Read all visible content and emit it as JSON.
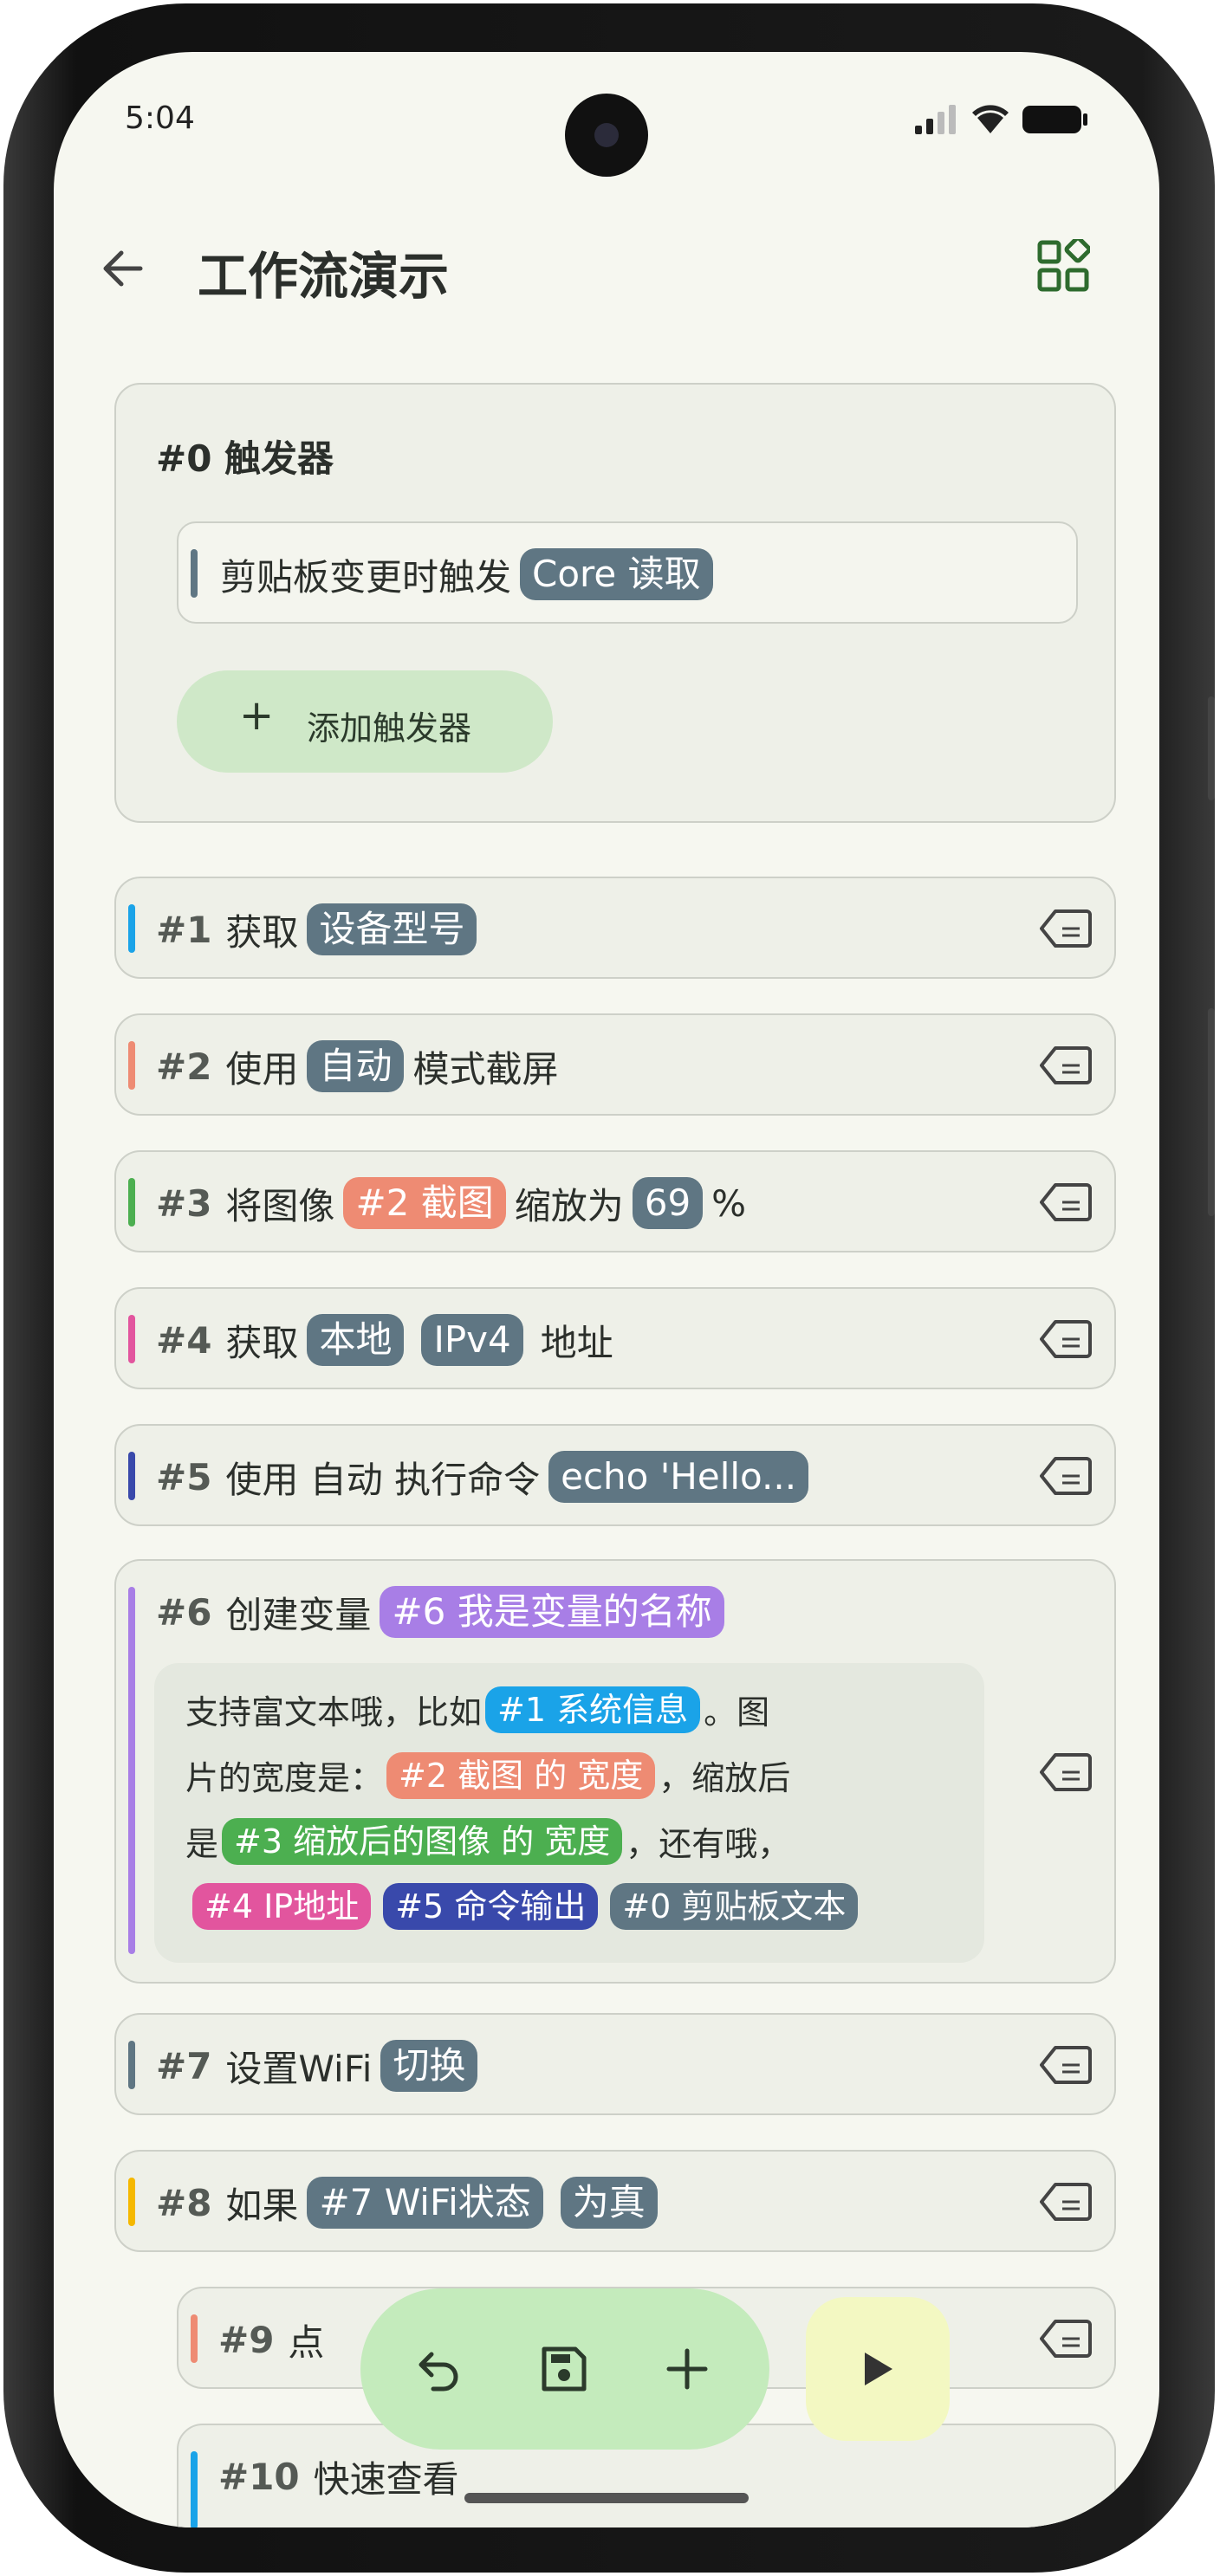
{
  "status": {
    "time": "5:04"
  },
  "appbar": {
    "title": "工作流演示"
  },
  "trigger": {
    "header": "#0 触发器",
    "item_text": "剪贴板变更时触发",
    "item_chip": "Core 读取",
    "add_label": "添加触发器"
  },
  "steps": [
    {
      "num": "#1",
      "parts": [
        {
          "t": "获取"
        },
        {
          "chip": "设备型号"
        }
      ]
    },
    {
      "num": "#2",
      "parts": [
        {
          "t": "使用"
        },
        {
          "chip": "自动"
        },
        {
          "t": "模式截屏"
        }
      ]
    },
    {
      "num": "#3",
      "parts": [
        {
          "t": "将图像"
        },
        {
          "chip": "#2 截图"
        },
        {
          "t": "缩放为"
        },
        {
          "chip": "69"
        },
        {
          "t": "%"
        }
      ]
    },
    {
      "num": "#4",
      "parts": [
        {
          "t": "获取"
        },
        {
          "chip": "本地"
        },
        {
          "chip": "IPv4"
        },
        {
          "t": "地址"
        }
      ]
    },
    {
      "num": "#5",
      "parts": [
        {
          "t": "使用 自动 执行命令"
        },
        {
          "chip": "echo 'Hello..."
        }
      ]
    },
    {
      "num": "#6",
      "parts": [
        {
          "t": "创建变量"
        },
        {
          "chip": "#6 我是变量的名称"
        }
      ]
    },
    {
      "num": "#7",
      "parts": [
        {
          "t": "设置WiFi"
        },
        {
          "chip": "切换"
        }
      ]
    },
    {
      "num": "#8",
      "parts": [
        {
          "t": "如果"
        },
        {
          "chip": "#7 WiFi状态"
        },
        {
          "chip": "为真"
        }
      ]
    },
    {
      "num": "#9",
      "parts": [
        {
          "t": "点"
        }
      ]
    },
    {
      "num": "#10",
      "parts": [
        {
          "t": "快速查看"
        }
      ]
    }
  ],
  "rich": {
    "r1a": "支持富文本哦，比如",
    "r1chip": "#1 系统信息",
    "r1b": "。图",
    "r2a": "片的宽度是：",
    "r2chip": "#2 截图 的 宽度",
    "r2b": "，缩放后",
    "r3a": "是",
    "r3chip": "#3 缩放后的图像 的 宽度",
    "r3b": "，还有哦，",
    "r4c1": "#4 IP地址",
    "r4c2": "#5 命令输出",
    "r4c3": "#0 剪贴板文本"
  },
  "colors": {
    "blue": "#1aa3e8",
    "salmon": "#ee8b73",
    "green": "#4caf50",
    "pink": "#e2559e",
    "indigo": "#3949ab",
    "purple": "#a87ee6",
    "slate": "#5f7683",
    "amber": "#f5b800"
  }
}
